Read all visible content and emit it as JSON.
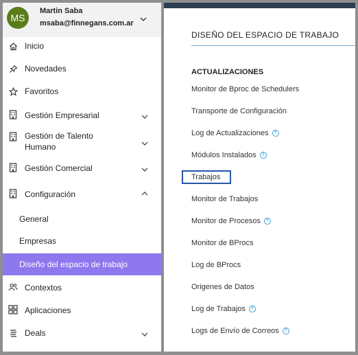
{
  "profile": {
    "initials": "MS",
    "name": "Martin Saba",
    "email": "msaba@finnegans.com.ar"
  },
  "sidebar": {
    "items": [
      {
        "label": "Inicio",
        "icon": "home-icon"
      },
      {
        "label": "Novedades",
        "icon": "pin-icon"
      },
      {
        "label": "Favoritos",
        "icon": "star-icon"
      },
      {
        "label": "Gestión Empresarial",
        "icon": "building-icon"
      },
      {
        "label": "Gestión de Talento Humano",
        "icon": "building-icon"
      },
      {
        "label": "Gestión Comercial",
        "icon": "building-icon"
      },
      {
        "label": "Configuración",
        "icon": "building-icon"
      },
      {
        "label": "Contextos",
        "icon": "people-icon"
      },
      {
        "label": "Aplicaciones",
        "icon": "apps-grid-icon"
      },
      {
        "label": "Deals",
        "icon": "list-icon"
      }
    ],
    "sub_items": [
      {
        "label": "General"
      },
      {
        "label": "Empresas"
      },
      {
        "label": "Diseño del espacio de trabajo",
        "active": true
      }
    ],
    "active_color": "#8e78ee"
  },
  "main": {
    "section_title": "DISEÑO DEL ESPACIO DE TRABAJO",
    "group_title": "ACTUALIZACIONES",
    "links": [
      {
        "label": "Monitor de Bproc de Schedulers",
        "help": false
      },
      {
        "label": "Transporte de Configuración",
        "help": false
      },
      {
        "label": "Log de Actualizaciones",
        "help": true
      },
      {
        "label": "Módulos Instalados",
        "help": true
      },
      {
        "label": "Trabajos",
        "help": false,
        "highlighted": true
      },
      {
        "label": "Monitor de Trabajos",
        "help": false
      },
      {
        "label": "Monitor de Procesos",
        "help": true
      },
      {
        "label": "Monitor de BProcs",
        "help": false
      },
      {
        "label": "Log de BProcs",
        "help": false
      },
      {
        "label": "Origenes de Datos",
        "help": false
      },
      {
        "label": "Log de Trabajos",
        "help": true
      },
      {
        "label": "Logs de Envío de Correos",
        "help": true
      }
    ],
    "help_glyph": "?"
  }
}
